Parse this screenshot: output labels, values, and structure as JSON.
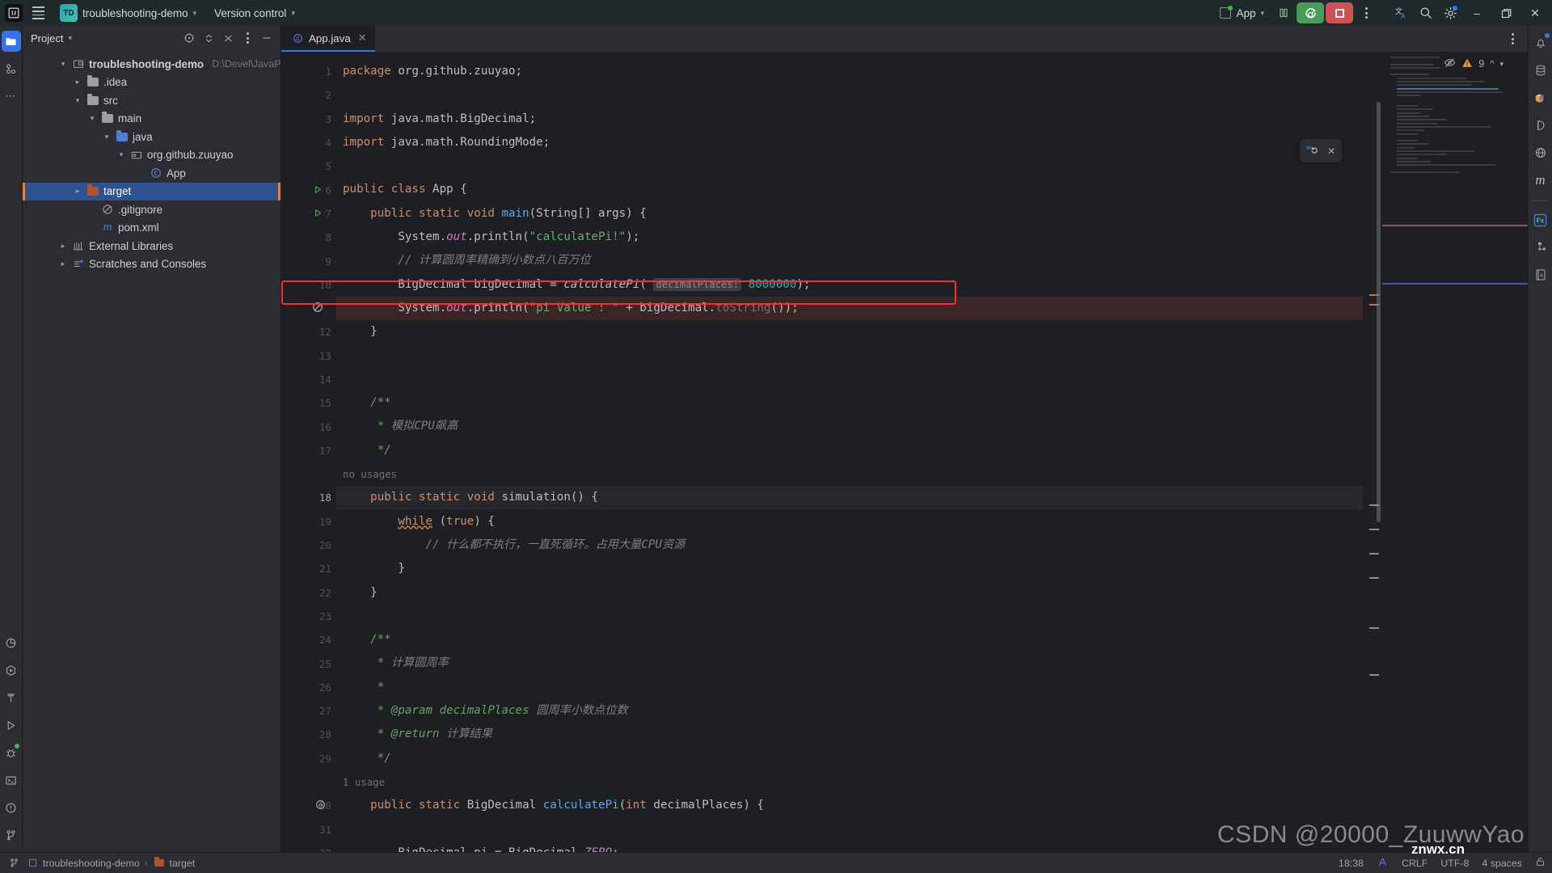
{
  "titlebar": {
    "logo_icon": "intellij-logo-icon",
    "menu_icon": "hamburger-menu-icon",
    "project_badge": "TD",
    "project_name": "troubleshooting-demo",
    "version_control": "Version control",
    "run_config": "App",
    "run_config_icon": "run-configuration-icon",
    "pause_icon": "pause-icon",
    "run_icon": "run-with-coverage-icon",
    "stop_icon": "stop-icon",
    "more_icon": "more-vertical-icon",
    "translate_icon": "translate-icon",
    "search_icon": "search-icon",
    "settings_icon": "gear-icon",
    "minimize_icon": "minimize-icon",
    "maximize_icon": "maximize-icon",
    "close_icon": "close-icon"
  },
  "left_rail": [
    {
      "name": "project-tool-icon",
      "icon": "folder",
      "selected": true
    },
    {
      "name": "commit-tool-icon",
      "icon": "commit"
    },
    {
      "name": "more-tool-icon",
      "icon": "dots"
    }
  ],
  "left_rail_bottom": [
    {
      "name": "profiler-tool-icon",
      "icon": "pie"
    },
    {
      "name": "services-tool-icon",
      "icon": "play-hex"
    },
    {
      "name": "build-tool-icon",
      "icon": "hammer"
    },
    {
      "name": "run-tool-icon",
      "icon": "play"
    },
    {
      "name": "debug-tool-icon",
      "icon": "bug"
    },
    {
      "name": "terminal-tool-icon",
      "icon": "terminal"
    },
    {
      "name": "problems-tool-icon",
      "icon": "warning"
    },
    {
      "name": "version-control-tool-icon",
      "icon": "branch"
    }
  ],
  "right_rail": [
    {
      "name": "notifications-icon",
      "icon": "bell",
      "badge": true
    },
    {
      "name": "database-icon",
      "icon": "db"
    },
    {
      "name": "maven-package-icon",
      "icon": "cube"
    },
    {
      "name": "ai-assistant-icon",
      "icon": "d"
    },
    {
      "name": "endpoints-icon",
      "icon": "globe"
    },
    {
      "name": "maven-icon",
      "icon": "m"
    },
    {
      "name": "fx-icon",
      "icon": "fx"
    },
    {
      "name": "structure-icon",
      "icon": "struct"
    },
    {
      "name": "dictionary-icon",
      "icon": "book"
    }
  ],
  "project_panel": {
    "title": "Project",
    "chevron_icon": "chevron-down-icon",
    "tools": [
      {
        "name": "select-opened-file-icon",
        "glyph": "target"
      },
      {
        "name": "expand-collapse-icon",
        "glyph": "expand"
      },
      {
        "name": "collapse-all-icon",
        "glyph": "collapse"
      },
      {
        "name": "options-icon",
        "glyph": "dots"
      },
      {
        "name": "hide-panel-icon",
        "glyph": "minus"
      }
    ],
    "tree": [
      {
        "label": "troubleshooting-demo",
        "path": "D:\\Devel\\JavaPro",
        "indent": 0,
        "arrow": "down",
        "icon": "module",
        "bold": true
      },
      {
        "label": ".idea",
        "indent": 1,
        "arrow": "right",
        "icon": "folder-grey"
      },
      {
        "label": "src",
        "indent": 1,
        "arrow": "down",
        "icon": "folder-grey"
      },
      {
        "label": "main",
        "indent": 2,
        "arrow": "down",
        "icon": "folder-grey"
      },
      {
        "label": "java",
        "indent": 3,
        "arrow": "down",
        "icon": "folder-blue"
      },
      {
        "label": "org.github.zuuyao",
        "indent": 4,
        "arrow": "down",
        "icon": "package"
      },
      {
        "label": "App",
        "indent": 5,
        "arrow": "none",
        "icon": "class"
      },
      {
        "label": "target",
        "indent": 1,
        "arrow": "right",
        "icon": "folder-orange",
        "selected": true
      },
      {
        "label": ".gitignore",
        "indent": 2,
        "arrow": "none",
        "icon": "gitignore"
      },
      {
        "label": "pom.xml",
        "indent": 2,
        "arrow": "none",
        "icon": "maven"
      },
      {
        "label": "External Libraries",
        "indent": 0,
        "arrow": "right",
        "icon": "libraries"
      },
      {
        "label": "Scratches and Consoles",
        "indent": 0,
        "arrow": "right",
        "icon": "scratches"
      }
    ]
  },
  "editor": {
    "tab_label": "App.java",
    "tab_icon": "java-class-icon",
    "tab_close_icon": "close-icon",
    "tabbar_options_icon": "more-vertical-icon",
    "inspection": {
      "eye_icon": "eye-off-icon",
      "warning_icon": "warning-triangle-icon",
      "warning_count": "9",
      "prev_icon": "chevron-up-icon",
      "next_icon": "chevron-down-icon"
    },
    "float_widget": {
      "reload_icon": "maven-reload-icon",
      "close_icon": "close-icon"
    },
    "lines": [
      {
        "n": "1",
        "html": "<span class='kw'>package</span> org.github.zuuyao;"
      },
      {
        "n": "2",
        "html": ""
      },
      {
        "n": "3",
        "html": "<span class='kw'>import</span> java.math.BigDecimal;"
      },
      {
        "n": "4",
        "html": "<span class='kw'>import</span> java.math.RoundingMode;"
      },
      {
        "n": "5",
        "html": ""
      },
      {
        "n": "6",
        "html": "<span class='kw'>public class</span> App {",
        "mark": "run"
      },
      {
        "n": "7",
        "html": "    <span class='kw'>public static void</span> <span class='fn'>main</span>(String[] args) {",
        "mark": "run"
      },
      {
        "n": "8",
        "html": "        System.<span class='fld'>out</span>.println(<span class='str'>\"calculatePi!\"</span>);"
      },
      {
        "n": "9",
        "html": "        <span class='cmt'>// 计算圆周率精确到小数点八百万位</span>"
      },
      {
        "n": "10",
        "html": "        BigDecimal bigDecimal = <span class='meth-it'>calculatePi</span>( <span class='param-hint'>decimalPlaces:</span> <span class='num'>8000000</span>);",
        "boxed": true
      },
      {
        "n": "",
        "html": "        System.<span class='fld'>out</span>.println(<span class='str'>\"pi Value : \"</span> + bigDecimal.<span class='greyed'>toString</span>());",
        "mark": "suppress",
        "err": true
      },
      {
        "n": "12",
        "html": "    }"
      },
      {
        "n": "13",
        "html": ""
      },
      {
        "n": "14",
        "html": ""
      },
      {
        "n": "15",
        "html": "    <span class='cmt-tag'>/**</span>"
      },
      {
        "n": "16",
        "html": "     <span class='cmt-tag'>*</span> <span class='cmt'>模拟CPU飙高</span>"
      },
      {
        "n": "17",
        "html": "     <span class='cmt-tag'>*/</span>"
      },
      {
        "hint": "no usages"
      },
      {
        "n": "18",
        "html": "    <span class='kw'>public static void</span> simulation() {",
        "caret": true
      },
      {
        "n": "19",
        "html": "        <span class='kw wavy'>while</span> (<span class='kw'>true</span>) {"
      },
      {
        "n": "20",
        "html": "            <span class='cmt'>// 什么都不执行，一直死循环。占用大量CPU资源</span>"
      },
      {
        "n": "21",
        "html": "        }"
      },
      {
        "n": "22",
        "html": "    }"
      },
      {
        "n": "23",
        "html": ""
      },
      {
        "n": "24",
        "html": "    <span class='cmt-tag'>/**</span>"
      },
      {
        "n": "25",
        "html": "     <span class='cmt-tag'>*</span> <span class='cmt'>计算圆周率</span>"
      },
      {
        "n": "26",
        "html": "     <span class='cmt-tag'>*</span>"
      },
      {
        "n": "27",
        "html": "     <span class='cmt-tag'>* @param decimalPlaces</span> <span class='cmt'>圆周率小数点位数</span>"
      },
      {
        "n": "28",
        "html": "     <span class='cmt-tag'>* @return</span> <span class='cmt'>计算结果</span>"
      },
      {
        "n": "29",
        "html": "     <span class='cmt-tag'>*/</span>"
      },
      {
        "hint": "1 usage"
      },
      {
        "n": "30",
        "html": "    <span class='kw'>public static</span> BigDecimal <span class='fn'>calculatePi</span>(<span class='kw'>int</span> decimalPlaces) {",
        "mark": "at"
      },
      {
        "n": "31",
        "html": ""
      },
      {
        "n": "32",
        "html": "        BigDecimal <span class='uline'>pi</span> = BigDecimal.<span class='fld'>ZERO</span>;"
      }
    ]
  },
  "statusbar": {
    "branch_icon": "branch-icon",
    "crumb_project": "troubleshooting-demo",
    "crumb_project_icon": "module-icon",
    "crumb_folder": "target",
    "crumb_folder_icon": "folder-icon",
    "time": "18:38",
    "ai_icon": "ai-assistant-icon",
    "line_sep": "CRLF",
    "encoding": "UTF-8",
    "indent": "4 spaces",
    "lock_icon": "unlocked-icon"
  },
  "watermark": {
    "text": "CSDN @20000_ZuuwwYao",
    "overlay": "znwx.cn"
  },
  "colors": {
    "accent_blue": "#3574f0",
    "run_green": "#4a9a5a",
    "stop_red": "#cf5055",
    "error_red": "#ff2b2b",
    "selection_blue": "#2f5597",
    "warning_amber": "#e5a83a"
  }
}
